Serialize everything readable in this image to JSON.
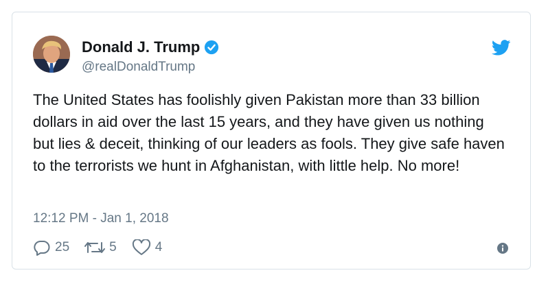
{
  "author": {
    "display_name": "Donald J. Trump",
    "handle": "@realDonaldTrump",
    "verified": true,
    "avatar_icon": "profile-photo"
  },
  "tweet": {
    "text": "The United States has foolishly given Pakistan more than 33 billion dollars in aid over the last 15 years, and they have given us nothing but lies & deceit, thinking of our leaders as fools. They give safe haven to the terrorists we hunt in Afghanistan, with little help. No more!",
    "timestamp": "12:12 PM - Jan 1, 2018"
  },
  "actions": {
    "replies": "25",
    "retweets": "5",
    "likes": "4"
  },
  "icons": {
    "brand": "twitter-bird-icon",
    "verified": "verified-badge-icon",
    "reply": "reply-icon",
    "retweet": "retweet-icon",
    "like": "heart-icon",
    "info": "info-icon"
  },
  "colors": {
    "brand_blue": "#1da1f2",
    "text": "#14171a",
    "muted": "#657786",
    "border": "#d9e1e7"
  }
}
